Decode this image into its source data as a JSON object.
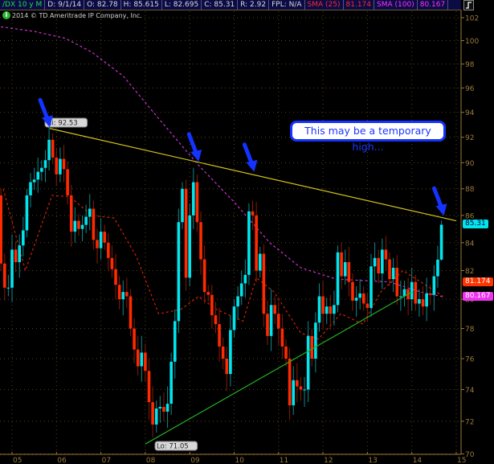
{
  "header": {
    "symbol": "/DX 10 y M",
    "date": "D: 9/1/14",
    "open": "O: 82.78",
    "high": "H: 85.615",
    "low": "L: 82.695",
    "close": "C: 85.31",
    "range": "R: 2.92",
    "fpl": "FPL: N/A",
    "sma25_label": "SMA (25)",
    "sma25_value": "81.174",
    "sma100_label": "SMA (100)",
    "sma100_value": "80.167"
  },
  "copyright": "2014 © TD Ameritrade IP Company, Inc.",
  "info_icon": "i",
  "callout": "This may be a temporary high...",
  "colors": {
    "up": "#00e5ee",
    "down": "#ff2a00",
    "sma25": "#cc2200",
    "sma100": "#cc33cc",
    "resistance": "#d4c21a",
    "support": "#22b022",
    "arrow": "#1433ff",
    "grid": "#5a4418",
    "axis": "#9a7a3a"
  },
  "chart_data": {
    "type": "candlestick",
    "scale": "log",
    "ylim": [
      70,
      102
    ],
    "yticks": [
      70,
      72,
      74,
      76,
      78,
      80,
      82,
      84,
      86,
      88,
      90,
      92,
      94,
      96,
      98,
      100,
      102
    ],
    "xticks": [
      "05",
      "06",
      "07",
      "08",
      "09",
      "10",
      "11",
      "12",
      "13",
      "14",
      "15"
    ],
    "start_month": "2004-10",
    "first_open": 87.5,
    "closes": [
      82.5,
      80.8,
      80.8,
      83.5,
      82.6,
      83.8,
      84.9,
      87.5,
      88.5,
      88.7,
      89.3,
      89.6,
      90.2,
      91.8,
      90.4,
      89.1,
      90.3,
      89.5,
      87.5,
      84.8,
      85.6,
      85.0,
      85.3,
      85.9,
      86.5,
      84.2,
      83.6,
      84.8,
      84.0,
      82.9,
      82.1,
      81.0,
      80.0,
      80.5,
      80.2,
      78.0,
      76.6,
      75.5,
      76.4,
      75.2,
      73.2,
      71.8,
      72.8,
      72.9,
      72.6,
      73.1,
      75.8,
      78.5,
      85.5,
      88.0,
      81.5,
      86.0,
      88.5,
      85.5,
      82.8,
      80.5,
      80.3,
      78.9,
      78.3,
      76.8,
      76.0,
      75.0,
      77.9,
      79.5,
      80.2,
      81.1,
      81.7,
      86.3,
      86.0,
      82.0,
      83.2,
      79.0,
      77.5,
      79.6,
      79.0,
      78.0,
      76.8,
      76.0,
      73.0,
      74.6,
      74.2,
      74.0,
      74.0,
      77.5,
      76.0,
      78.4,
      80.2,
      79.0,
      79.5,
      79.0,
      79.6,
      83.3,
      81.6,
      82.6,
      81.2,
      79.9,
      80.1,
      80.4,
      79.7,
      79.4,
      82.3,
      82.9,
      81.8,
      83.5,
      82.8,
      81.4,
      82.2,
      80.2,
      80.2,
      80.7,
      80.0,
      81.2,
      79.7,
      80.0,
      79.5,
      80.4,
      80.3,
      81.6,
      82.78,
      85.31
    ],
    "last_candle": {
      "open": 82.78,
      "high": 85.615,
      "low": 82.695,
      "close": 85.31
    },
    "sma25": [
      [
        2004.8,
        88
      ],
      [
        2005.3,
        82
      ],
      [
        2005.9,
        87.5
      ],
      [
        2006.3,
        87.4
      ],
      [
        2006.8,
        86
      ],
      [
        2007.3,
        85.8
      ],
      [
        2007.8,
        83
      ],
      [
        2008.3,
        79
      ],
      [
        2008.8,
        79.3
      ],
      [
        2009.2,
        80.2
      ],
      [
        2009.6,
        79.3
      ],
      [
        2010.2,
        78.5
      ],
      [
        2010.5,
        81.5
      ],
      [
        2010.9,
        80.5
      ],
      [
        2011.5,
        77.7
      ],
      [
        2011.9,
        77.3
      ],
      [
        2012.4,
        79
      ],
      [
        2012.9,
        78.3
      ],
      [
        2013.3,
        80.5
      ],
      [
        2013.8,
        82.0
      ],
      [
        2014.3,
        81.0
      ],
      [
        2014.7,
        80.2
      ]
    ],
    "sma100": [
      [
        2004.75,
        101.2
      ],
      [
        2005.5,
        100.8
      ],
      [
        2006.2,
        100.2
      ],
      [
        2006.8,
        99
      ],
      [
        2007.5,
        97
      ],
      [
        2008.3,
        93.5
      ],
      [
        2009.2,
        89.8
      ],
      [
        2010.0,
        87
      ],
      [
        2010.8,
        84
      ],
      [
        2011.5,
        82.2
      ],
      [
        2012.3,
        81.4
      ],
      [
        2013.5,
        81.2
      ],
      [
        2014.2,
        80.5
      ],
      [
        2014.7,
        80.167
      ]
    ],
    "resistance_line": [
      [
        2005.85,
        92.7
      ],
      [
        2015.0,
        85.6
      ]
    ],
    "support_line": [
      [
        2008.0,
        70.6
      ],
      [
        2014.0,
        80.5
      ]
    ],
    "annotations": {
      "high_label": "Hi: 92.53",
      "low_label": "Lo: 71.05"
    },
    "arrows": [
      [
        2005.85,
        92.6
      ],
      [
        2009.2,
        89.9
      ],
      [
        2010.45,
        89.1
      ],
      [
        2014.72,
        85.8
      ]
    ],
    "price_badges": [
      {
        "value": "85.31",
        "level": 85.31,
        "color": "#00e5ee"
      },
      {
        "value": "81.174",
        "level": 81.174,
        "color": "#ff3300"
      },
      {
        "value": "80.167",
        "level": 80.167,
        "color": "#ee33ee"
      }
    ]
  }
}
